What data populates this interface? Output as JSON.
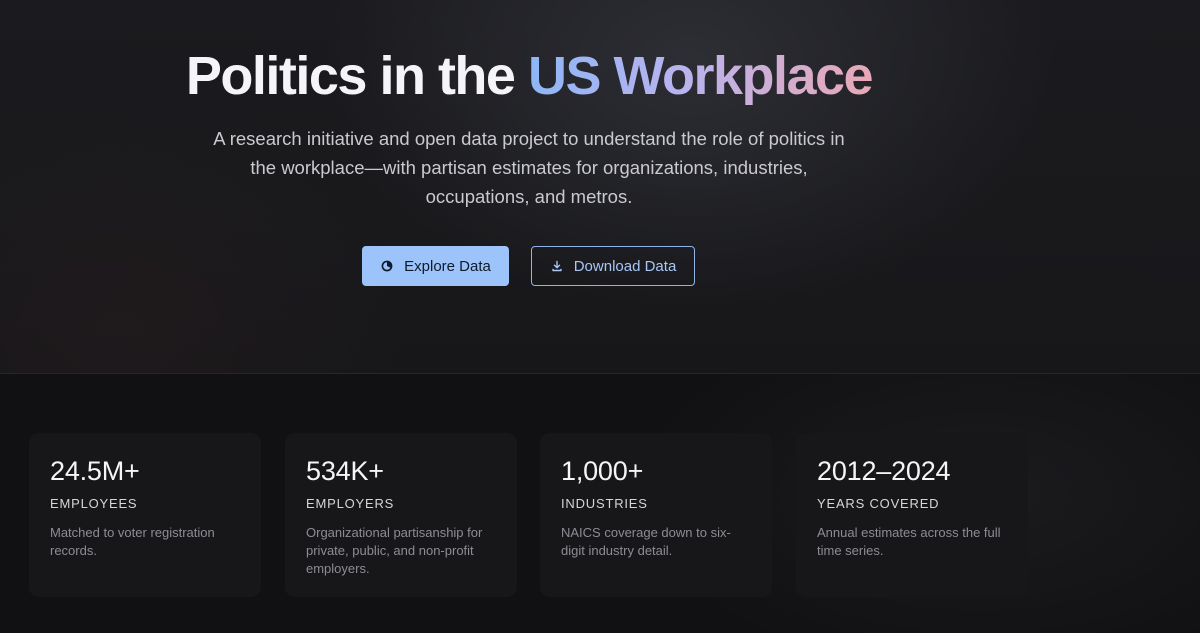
{
  "hero": {
    "title_plain": "Politics in the ",
    "title_accent": "US Workplace",
    "subtitle": "A research initiative and open data project to understand the role of politics in the workplace—with partisan estimates for organizations, industries, occupations, and metros.",
    "explore_button": {
      "label": "Explore Data",
      "icon": "chart-pie-icon"
    },
    "download_button": {
      "label": "Download Data",
      "icon": "download-icon"
    }
  },
  "stats": [
    {
      "value": "24.5M+",
      "label": "EMPLOYEES",
      "description": "Matched to voter registration records."
    },
    {
      "value": "534K+",
      "label": "EMPLOYERS",
      "description": "Organizational partisanship for private, public, and non-profit employers."
    },
    {
      "value": "1,000+",
      "label": "INDUSTRIES",
      "description": "NAICS coverage down to six-digit industry detail."
    },
    {
      "value": "2012–2024",
      "label": "YEARS COVERED",
      "description": "Annual estimates across the full time series."
    }
  ],
  "colors": {
    "accent_blue": "#9cc4fb",
    "accent_gradient_start": "#8eb6f6",
    "accent_gradient_end": "#e9a8b5",
    "background": "#111113",
    "card_background": "#17171a"
  }
}
